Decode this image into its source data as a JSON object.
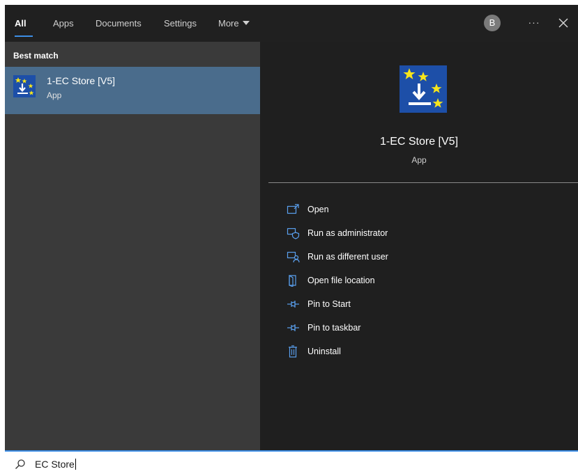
{
  "tabs": [
    {
      "label": "All",
      "active": true
    },
    {
      "label": "Apps"
    },
    {
      "label": "Documents"
    },
    {
      "label": "Settings"
    },
    {
      "label": "More"
    }
  ],
  "user": {
    "avatar_letter": "B"
  },
  "toolbar": {
    "more_options": "···"
  },
  "left_pane": {
    "section_label": "Best match",
    "result": {
      "title": "1-EC Store [V5]",
      "subtitle": "App"
    }
  },
  "detail": {
    "title": "1-EC Store [V5]",
    "subtitle": "App",
    "actions": [
      {
        "label": "Open",
        "icon": "open-icon"
      },
      {
        "label": "Run as administrator",
        "icon": "shield-icon"
      },
      {
        "label": "Run as different user",
        "icon": "user-switch-icon"
      },
      {
        "label": "Open file location",
        "icon": "folder-icon"
      },
      {
        "label": "Pin to Start",
        "icon": "pin-icon"
      },
      {
        "label": "Pin to taskbar",
        "icon": "pin-icon"
      },
      {
        "label": "Uninstall",
        "icon": "trash-icon"
      }
    ]
  },
  "search": {
    "query": "EC Store"
  },
  "colors": {
    "accent": "#3d8ee6",
    "selected_row": "#4a6c8c",
    "icon_blue": "#1d4fa8",
    "star_yellow": "#f7e51b"
  }
}
